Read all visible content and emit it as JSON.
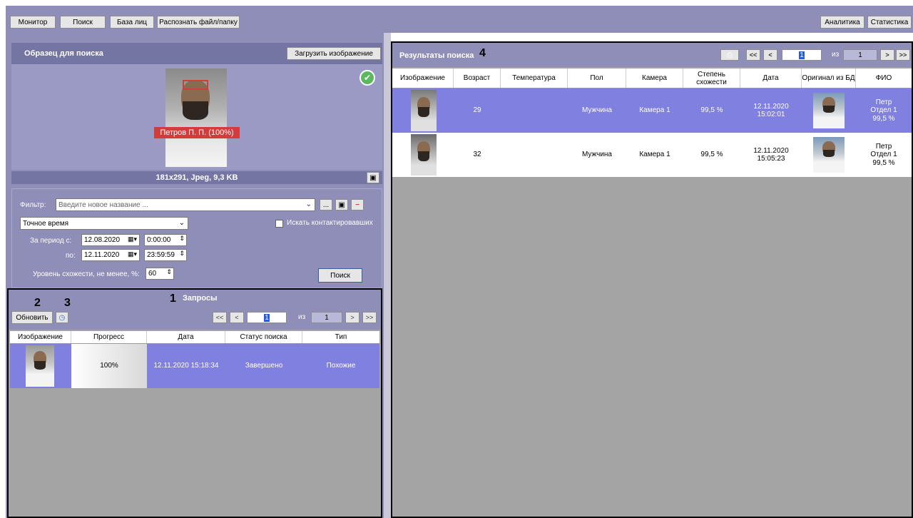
{
  "toolbar": {
    "monitor": "Монитор",
    "search": "Поиск",
    "face_db": "База лиц",
    "recognize": "Распознать файл/папку",
    "analytics": "Аналитика",
    "statistics": "Статистика"
  },
  "sample": {
    "title": "Образец для поиска",
    "upload_label": "Загрузить изображение",
    "face_label": "Петров П. П. (100%)",
    "image_info": "181x291, Jpeg, 9,3 KB"
  },
  "filter": {
    "label": "Фильтр:",
    "placeholder": "Введите новое название ...",
    "ellipsis": "...",
    "mode": "Точное время",
    "contacts_label": "Искать контактировавших",
    "period_from_label": "За период с:",
    "date_from": "12.08.2020",
    "time_from": "0:00:00",
    "period_to_label": "по:",
    "date_to": "12.11.2020",
    "time_to": "23:59:59",
    "similarity_label": "Уровень схожести, не менее, %:",
    "similarity": "60",
    "search_button": "Поиск"
  },
  "requests": {
    "title": "Запросы",
    "refresh": "Обновить",
    "pager": {
      "first": "<<",
      "prev": "<",
      "page": "1",
      "of": "из",
      "total": "1",
      "next": ">",
      "last": ">>"
    },
    "columns": [
      "Изображение",
      "Прогресс",
      "Дата",
      "Статус поиска",
      "Тип"
    ],
    "rows": [
      {
        "progress": "100%",
        "date": "12.11.2020 15:18:34",
        "status": "Завершено",
        "type": "Похожие"
      }
    ]
  },
  "results": {
    "title": "Результаты поиска",
    "pager": {
      "first": "<<",
      "prev": "<",
      "page": "1",
      "of": "из",
      "total": "1",
      "next": ">",
      "last": ">>"
    },
    "columns": [
      "Изображение",
      "Возраст",
      "Температура",
      "Пол",
      "Камера",
      "Степень схожести",
      "Дата",
      "Оригинал из БД",
      "ФИО"
    ],
    "rows": [
      {
        "age": "29",
        "temperature": "",
        "gender": "Мужчина",
        "camera": "Камера 1",
        "similarity": "99,5 %",
        "date": "12.11.2020\n15:02:01",
        "fio": "Петр\nОтдел 1\n99,5 %"
      },
      {
        "age": "32",
        "temperature": "",
        "gender": "Мужчина",
        "camera": "Камера 1",
        "similarity": "99,5 %",
        "date": "12.11.2020\n15:05:23",
        "fio": "Петр\nОтдел 1\n99,5 %"
      }
    ]
  },
  "annotations": {
    "a1": "1",
    "a2": "2",
    "a3": "3",
    "a4": "4"
  },
  "colors": {
    "panel": "#8e8eb8",
    "selected_row": "#8080e0",
    "grid_bg": "#a4a4a4",
    "accent_green": "#5cb85c",
    "face_label_red": "#d43c3c"
  }
}
